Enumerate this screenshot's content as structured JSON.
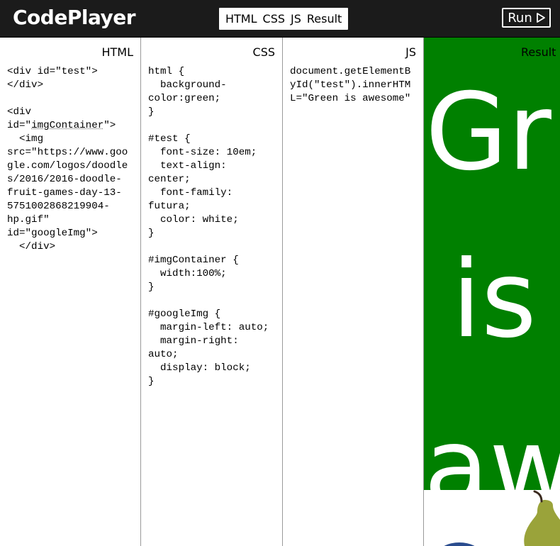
{
  "app": {
    "logo": "CodePlayer",
    "toggles": [
      "HTML",
      "CSS",
      "JS",
      "Result"
    ],
    "run_label": "Run"
  },
  "panels": {
    "html": {
      "label": "HTML",
      "code_lines": [
        "<div id=\"test\">",
        "</div>",
        "",
        "<div",
        "id=\"imgContainer\">",
        "  <img",
        "src=\"https://www.goo",
        "gle.com/logos/doodle",
        "s/2016/2016-doodle-",
        "fruit-games-day-13-",
        "5751002868219904-",
        "hp.gif\"",
        "id=\"googleImg\">",
        "  </div>"
      ]
    },
    "css": {
      "label": "CSS",
      "code_lines": [
        "html {",
        "  background-",
        "color:green;",
        "}",
        "",
        "#test {",
        "  font-size: 10em;",
        "  text-align:",
        "center;",
        "  font-family:",
        "futura;",
        "  color: white;",
        "}",
        "",
        "#imgContainer {",
        "  width:100%;",
        "}",
        "",
        "#googleImg {",
        "  margin-left: auto;",
        "  margin-right:",
        "auto;",
        "  display: block;",
        "}"
      ]
    },
    "js": {
      "label": "JS",
      "code_lines": [
        "document.getElementB",
        "yId(\"test\").innerHTM",
        "L=\"Green is awesome\""
      ]
    },
    "result": {
      "label": "Result",
      "words": [
        "Gr",
        "is",
        "aw"
      ],
      "background_color": "#008000",
      "text_color": "#ffffff"
    }
  },
  "colors": {
    "header_bg": "#1b1b1b",
    "divider": "#9a9a9a"
  }
}
